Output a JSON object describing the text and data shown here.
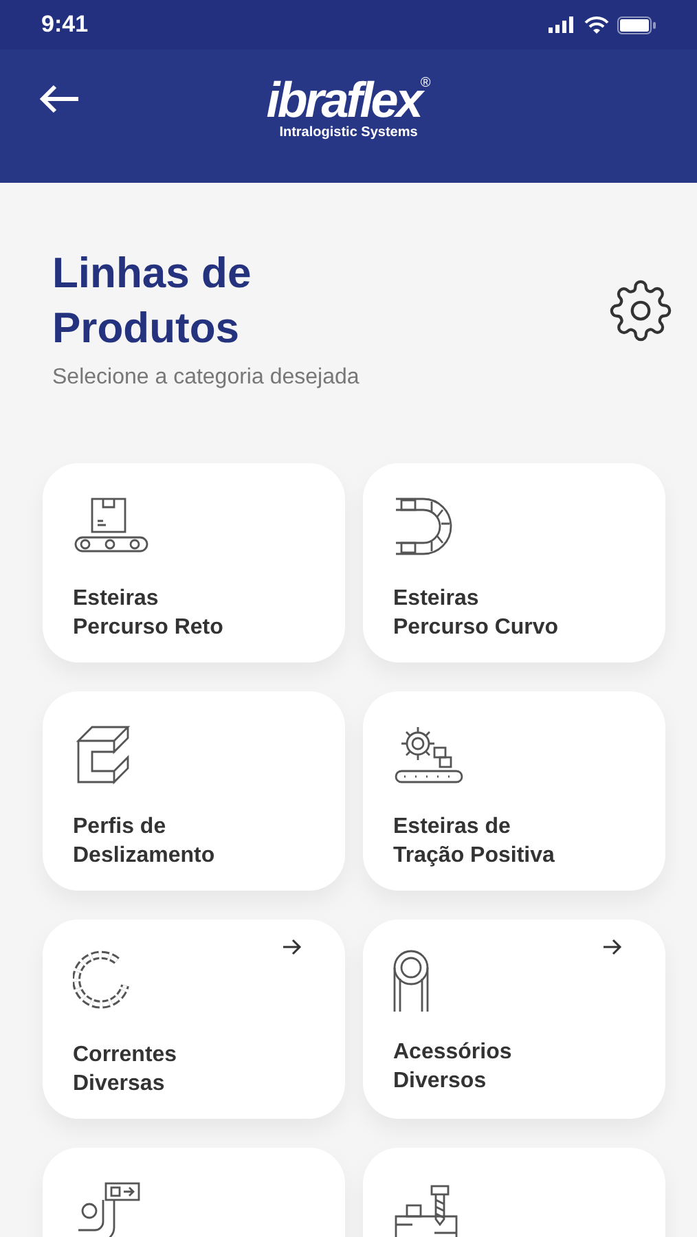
{
  "status_bar": {
    "time": "9:41"
  },
  "header": {
    "logo": {
      "brand": "ibraflex",
      "mark": "®",
      "tagline": "Intralogistic Systems"
    }
  },
  "page": {
    "title": "Linhas de Produtos",
    "subtitle": "Selecione a categoria desejada"
  },
  "categories": [
    {
      "kind": "straight-conveyor",
      "lines": [
        "Esteiras",
        "Percurso Reto"
      ],
      "has_arrow": false
    },
    {
      "kind": "curved-conveyor",
      "lines": [
        "Esteiras",
        "Percurso Curvo"
      ],
      "has_arrow": false
    },
    {
      "kind": "profile",
      "lines": [
        "Perfis de",
        "Deslizamento"
      ],
      "has_arrow": false
    },
    {
      "kind": "gear-conveyor",
      "lines": [
        "Esteiras de",
        "Tração Positiva"
      ],
      "has_arrow": false
    },
    {
      "kind": "chain",
      "lines": [
        "Correntes",
        "Diversas"
      ],
      "has_arrow": true
    },
    {
      "kind": "roller",
      "lines": [
        "Acessórios",
        "Diversos"
      ],
      "has_arrow": true
    },
    {
      "kind": "transfer",
      "has_arrow": false
    },
    {
      "kind": "screw-table",
      "has_arrow": false
    }
  ]
}
